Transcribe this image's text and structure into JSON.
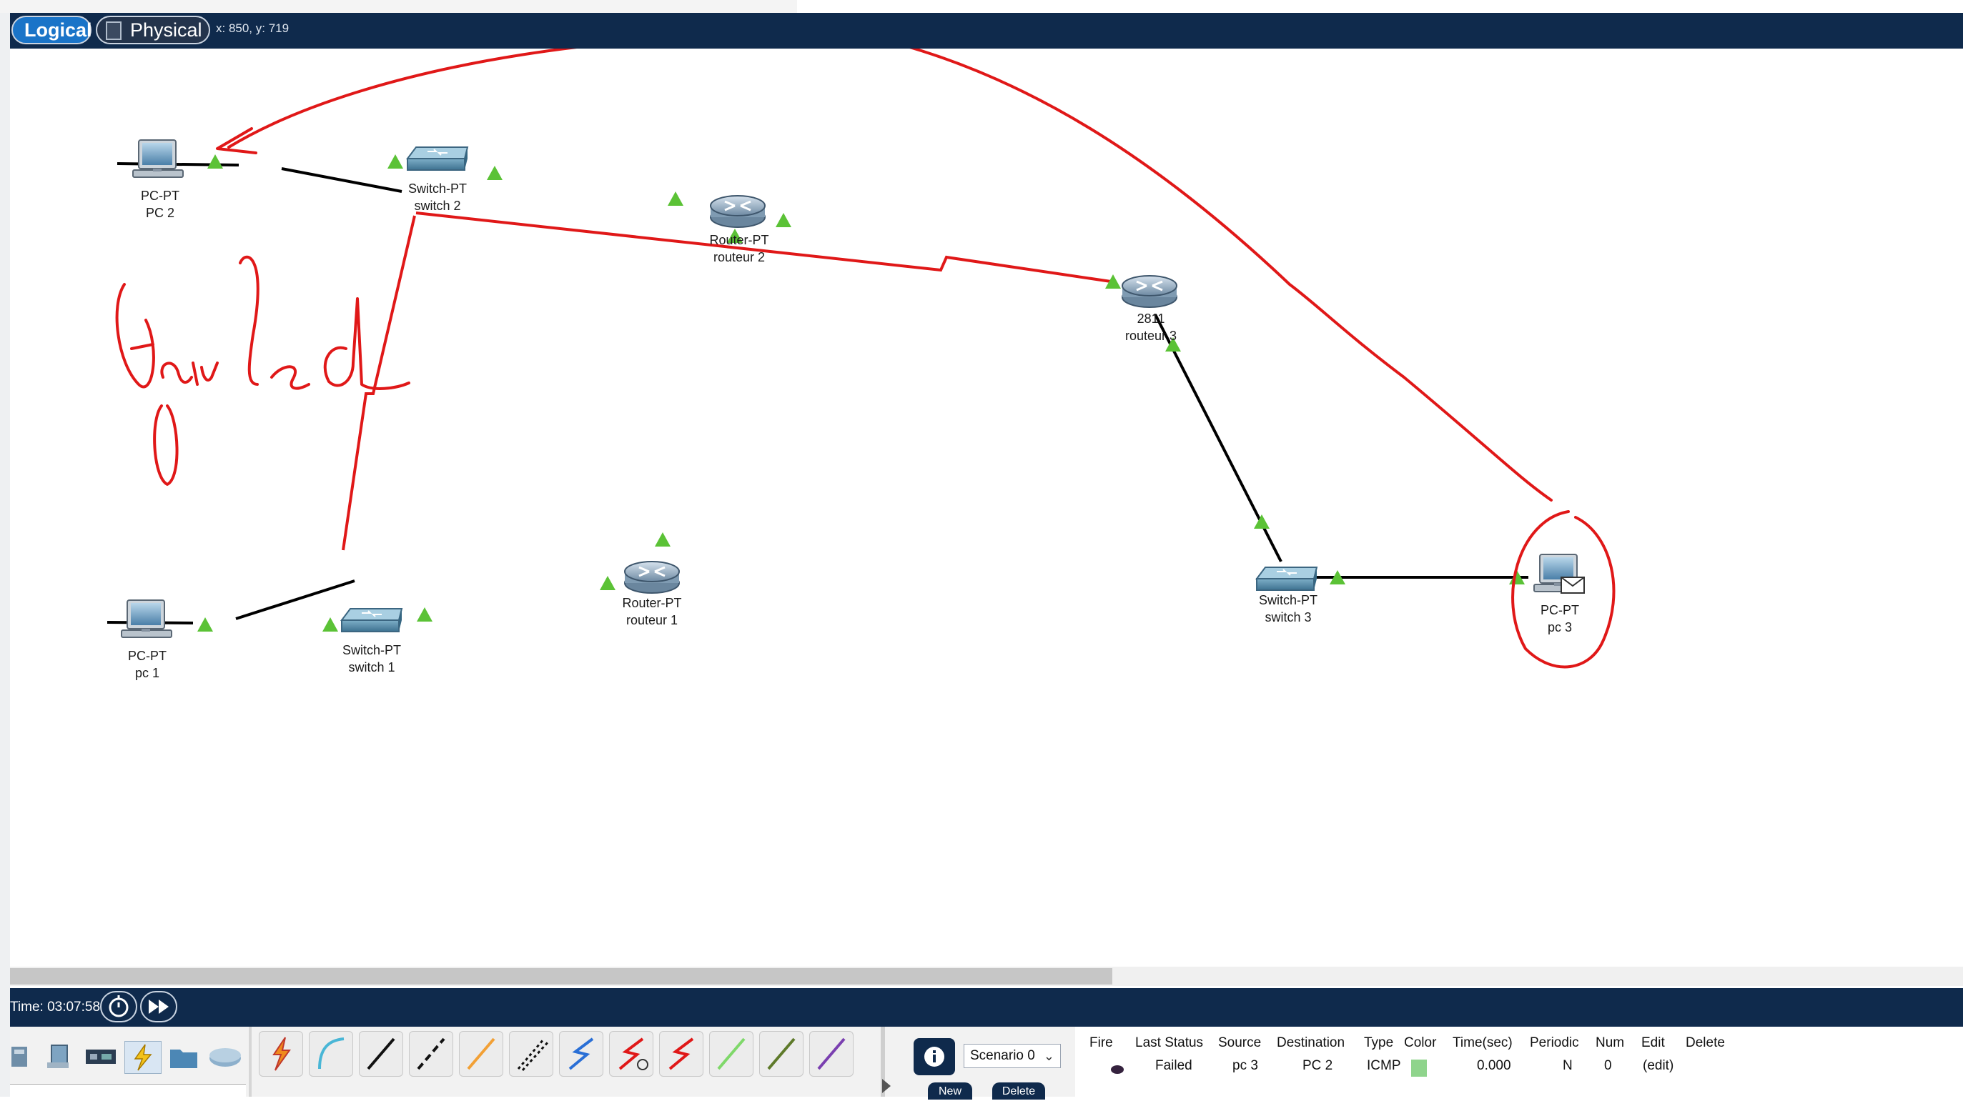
{
  "topbar": {
    "logical_tab": "Logical",
    "physical_tab": "Physical",
    "coords": "x: 850, y: 719"
  },
  "devices": {
    "pc2": {
      "model": "PC-PT",
      "name": "PC 2"
    },
    "switch2": {
      "model": "Switch-PT",
      "name": "switch 2"
    },
    "router2": {
      "model": "Router-PT",
      "name": "routeur 2"
    },
    "router3": {
      "model": "2811",
      "name": "routeur 3"
    },
    "router1": {
      "model": "Router-PT",
      "name": "routeur  1"
    },
    "switch1": {
      "model": "Switch-PT",
      "name": "switch 1"
    },
    "pc1": {
      "model": "PC-PT",
      "name": "pc 1"
    },
    "switch3": {
      "model": "Switch-PT",
      "name": "switch 3"
    },
    "pc3": {
      "model": "PC-PT",
      "name": "pc 3"
    }
  },
  "annotation": {
    "handwritten_text": "failed",
    "color": "#e01818"
  },
  "colors": {
    "link_ok": "#000000",
    "link_serial": "#e01818",
    "port_up": "#5bc236",
    "bar": "#0f2a4c",
    "tab_active": "#1a74c8"
  },
  "simulation": {
    "time": "Time: 03:07:58"
  },
  "scenario": {
    "selected": "Scenario 0",
    "new_label": "New",
    "delete_label": "Delete"
  },
  "pdu_table": {
    "headers": [
      "Fire",
      "Last Status",
      "Source",
      "Destination",
      "Type",
      "Color",
      "Time(sec)",
      "Periodic",
      "Num",
      "Edit",
      "Delete"
    ],
    "row": {
      "last_status": "Failed",
      "source": "pc 3",
      "destination": "PC 2",
      "type": "ICMP",
      "color": "#8fd48c",
      "time_sec": "0.000",
      "periodic": "N",
      "num": "0",
      "edit": "(edit)"
    }
  },
  "icons": [
    "logical-view-icon",
    "physical-view-icon",
    "reset-time-icon",
    "fast-forward-icon",
    "info-icon"
  ]
}
